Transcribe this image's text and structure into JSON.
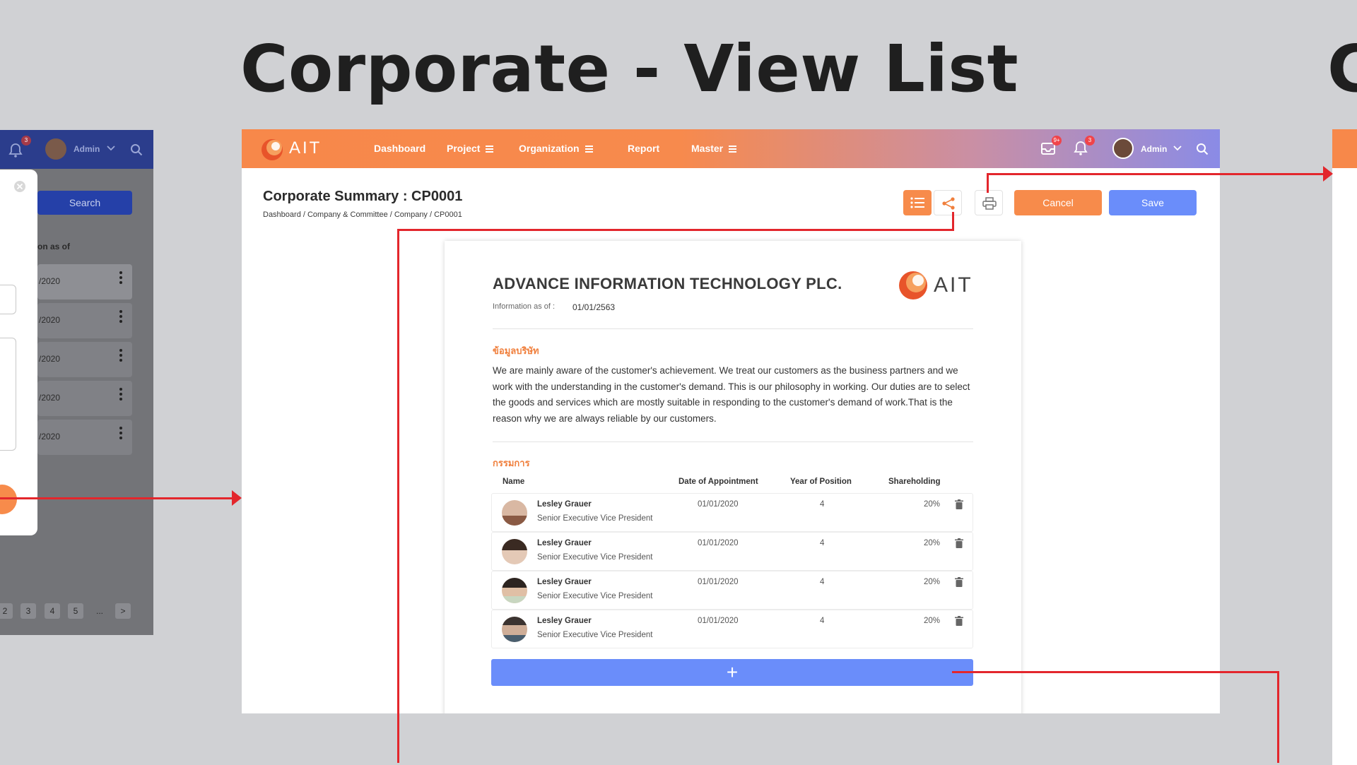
{
  "canvas": {
    "title": "Corporate - View List",
    "next_title_fragment": "C"
  },
  "left_screen": {
    "admin_label": "Admin",
    "search_button": "Search",
    "column_label": "on as of",
    "rows": [
      "/2020",
      "/2020",
      "/2020",
      "/2020",
      "/2020"
    ],
    "pagination": [
      "2",
      "3",
      "4",
      "5",
      "...",
      ">"
    ],
    "notification_count": "3"
  },
  "topbar": {
    "logo_text": "AIT",
    "nav": [
      {
        "label": "Dashboard",
        "menu": false
      },
      {
        "label": "Project",
        "menu": true
      },
      {
        "label": "Organization",
        "menu": true
      },
      {
        "label": "Report",
        "menu": false
      },
      {
        "label": "Master",
        "menu": true
      }
    ],
    "inbox_badge": "9+",
    "notification_badge": "3",
    "user_label": "Admin"
  },
  "page": {
    "title": "Corporate Summary : CP0001",
    "breadcrumb": "Dashboard / Company & Committee / Company / CP0001",
    "cancel_label": "Cancel",
    "save_label": "Save"
  },
  "document": {
    "company_name": "ADVANCE INFORMATION TECHNOLOGY PLC.",
    "logo_text": "AIT",
    "info_label": "Information as of :",
    "info_date": "01/01/2563",
    "about_title": "ข้อมูลบริษัท",
    "about_text": "We are mainly aware of the customer's achievement. We treat our customers as the business partners and we work with the understanding in the customer's demand. This is our philosophy in working. Our duties are to select the goods and services which are mostly suitable in responding to the customer's demand of work.That is the reason why we are always reliable by our customers.",
    "board_title": "กรรมการ",
    "table_headers": {
      "name": "Name",
      "date": "Date of Appointment",
      "year": "Year of Position",
      "share": "Shareholding"
    },
    "directors": [
      {
        "name": "Lesley Grauer",
        "position": "Senior Executive Vice President",
        "date": "01/01/2020",
        "year": "4",
        "share": "20%"
      },
      {
        "name": "Lesley Grauer",
        "position": "Senior Executive Vice President",
        "date": "01/01/2020",
        "year": "4",
        "share": "20%"
      },
      {
        "name": "Lesley Grauer",
        "position": "Senior Executive Vice President",
        "date": "01/01/2020",
        "year": "4",
        "share": "20%"
      },
      {
        "name": "Lesley Grauer",
        "position": "Senior Executive Vice President",
        "date": "01/01/2020",
        "year": "4",
        "share": "20%"
      }
    ],
    "add_label": "+"
  },
  "icons": {
    "list_view": "list-icon",
    "share": "share-icon",
    "print": "print-icon",
    "delete": "trash-icon",
    "search": "search-icon",
    "bell": "bell-icon",
    "inbox": "inbox-icon"
  },
  "colors": {
    "orange": "#f78b4b",
    "blue": "#6a8dfa",
    "navy": "#2b3d8c",
    "annotation_red": "#e3262c",
    "section_title": "#f07f3c"
  }
}
